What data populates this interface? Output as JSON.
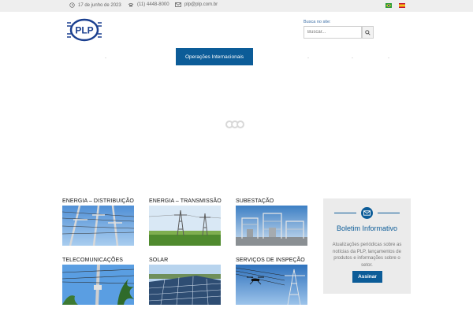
{
  "topbar": {
    "date": "17 de junho de 2023",
    "phone": "(11) 4448-8000",
    "email": "plp@plp.com.br",
    "flags": [
      "brazil-flag",
      "spain-flag"
    ]
  },
  "logo": {
    "text": "PLP"
  },
  "search": {
    "label": "Busca no site:",
    "placeholder": "Buscar..."
  },
  "nav": {
    "active_label": "Operações Internacionais"
  },
  "categories": [
    {
      "title": "ENERGIA – DISTRIBUIÇÃO"
    },
    {
      "title": "ENERGIA – TRANSMISSÃO"
    },
    {
      "title": "SUBESTAÇÃO"
    },
    {
      "title": "TELECOMUNICAÇÕES"
    },
    {
      "title": "SOLAR"
    },
    {
      "title": "SERVIÇOS DE INSPEÇÃO"
    }
  ],
  "newsletter": {
    "title": "Boletim Informativo",
    "text": "Atualizações periódicas sobre as notícias da PLP, lançamentos de produtos e informações sobre o setor.",
    "button": "Assinar"
  },
  "colors": {
    "brand": "#0c5c98",
    "topbar": "#eeeeee",
    "panel": "#ebebeb"
  }
}
